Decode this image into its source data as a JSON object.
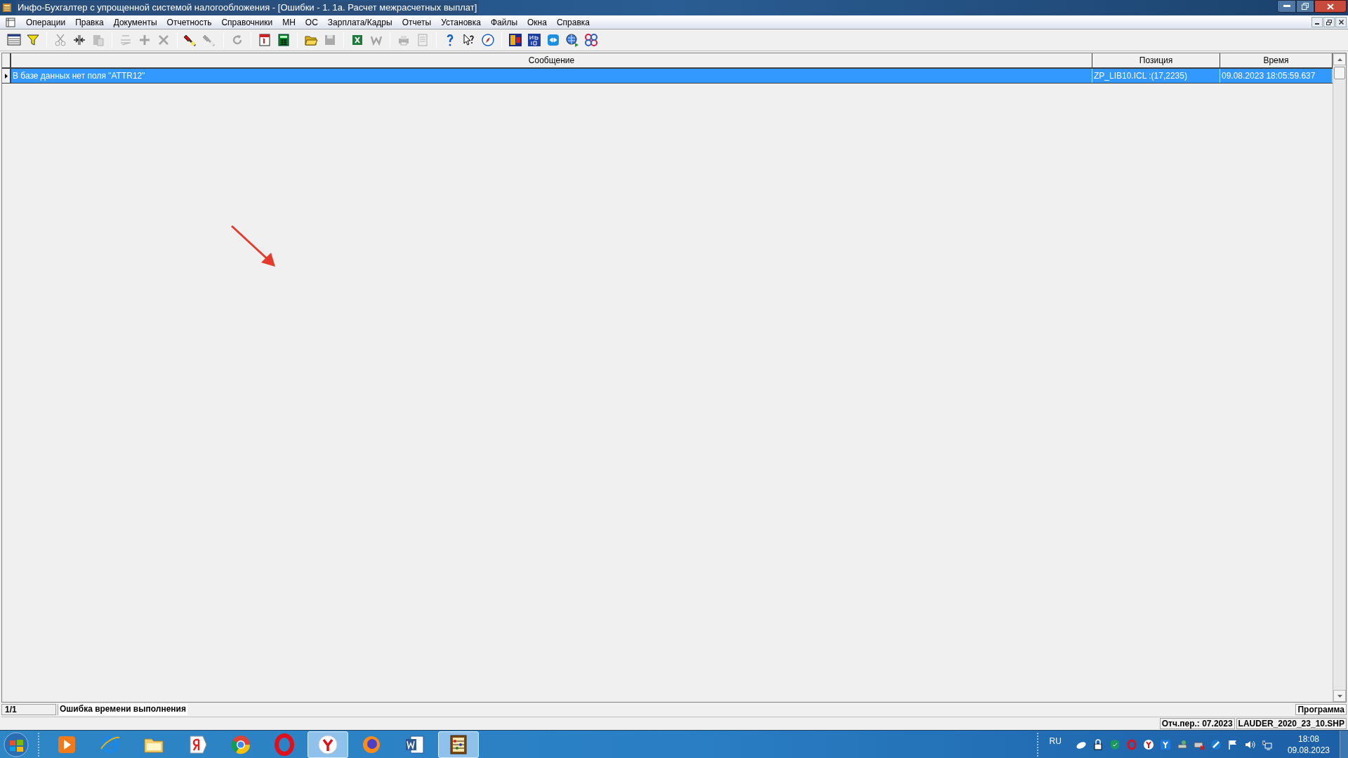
{
  "window": {
    "title": "Инфо-Бухгалтер с упрощенной системой налогообложения - [Ошибки - 1. 1а. Расчет межрасчетных выплат]"
  },
  "menu": [
    "Операции",
    "Правка",
    "Документы",
    "Отчетность",
    "Справочники",
    "МН",
    "ОС",
    "Зарплата/Кадры",
    "Отчеты",
    "Установка",
    "Файлы",
    "Окна",
    "Справка"
  ],
  "toolbar": [
    {
      "kind": "grid",
      "disabled": false
    },
    {
      "kind": "filter",
      "disabled": false
    },
    {
      "kind": "sep"
    },
    {
      "kind": "cut",
      "disabled": true
    },
    {
      "kind": "split",
      "disabled": false
    },
    {
      "kind": "paste",
      "disabled": true
    },
    {
      "kind": "sep"
    },
    {
      "kind": "rotate",
      "disabled": true
    },
    {
      "kind": "plus",
      "disabled": true
    },
    {
      "kind": "cross",
      "disabled": true
    },
    {
      "kind": "sep"
    },
    {
      "kind": "flashlight",
      "disabled": false
    },
    {
      "kind": "flashlight",
      "disabled": true
    },
    {
      "kind": "sep"
    },
    {
      "kind": "refresh",
      "disabled": true
    },
    {
      "kind": "sep"
    },
    {
      "kind": "calendar",
      "disabled": false
    },
    {
      "kind": "calculator",
      "disabled": false
    },
    {
      "kind": "sep"
    },
    {
      "kind": "folder",
      "disabled": false
    },
    {
      "kind": "save",
      "disabled": true
    },
    {
      "kind": "sep"
    },
    {
      "kind": "excel",
      "disabled": false
    },
    {
      "kind": "word",
      "disabled": true
    },
    {
      "kind": "sep"
    },
    {
      "kind": "printer",
      "disabled": true
    },
    {
      "kind": "preview",
      "disabled": true
    },
    {
      "kind": "sep"
    },
    {
      "kind": "help",
      "disabled": false
    },
    {
      "kind": "whatsthis",
      "disabled": false
    },
    {
      "kind": "compass",
      "disabled": false
    },
    {
      "kind": "sep"
    },
    {
      "kind": "app",
      "disabled": false
    },
    {
      "kind": "ib10",
      "disabled": false
    },
    {
      "kind": "remote",
      "disabled": false
    },
    {
      "kind": "globe",
      "disabled": false
    },
    {
      "kind": "pattern",
      "disabled": false
    }
  ],
  "table": {
    "columns": [
      "Сообщение",
      "Позиция",
      "Время"
    ],
    "rows": [
      {
        "selected": true,
        "cells": [
          "В базе данных нет поля \"ATTR12\"",
          "ZP_LIB10.ICL :(17,2235)",
          "09.08.2023 18:05:59.637"
        ]
      }
    ]
  },
  "status_bar": {
    "counter": "1/1",
    "message": "Ошибка времени выполнения",
    "mode": "Программа"
  },
  "info_bar": [
    "Отч.пер.: 07.2023",
    "LAUDER_2020_23_10.SHP"
  ],
  "taskbar": {
    "apps": [
      {
        "kind": "media",
        "selected": false
      },
      {
        "kind": "ie",
        "selected": false
      },
      {
        "kind": "explorer",
        "selected": false
      },
      {
        "kind": "yandex",
        "selected": false
      },
      {
        "kind": "chrome",
        "selected": false
      },
      {
        "kind": "opera",
        "selected": false
      },
      {
        "kind": "ybrowser",
        "selected": true
      },
      {
        "kind": "firefox",
        "selected": false
      },
      {
        "kind": "word",
        "selected": false
      },
      {
        "kind": "abacus",
        "selected": true
      }
    ],
    "language": "RU",
    "time": "18:08",
    "date": "09.08.2023"
  }
}
